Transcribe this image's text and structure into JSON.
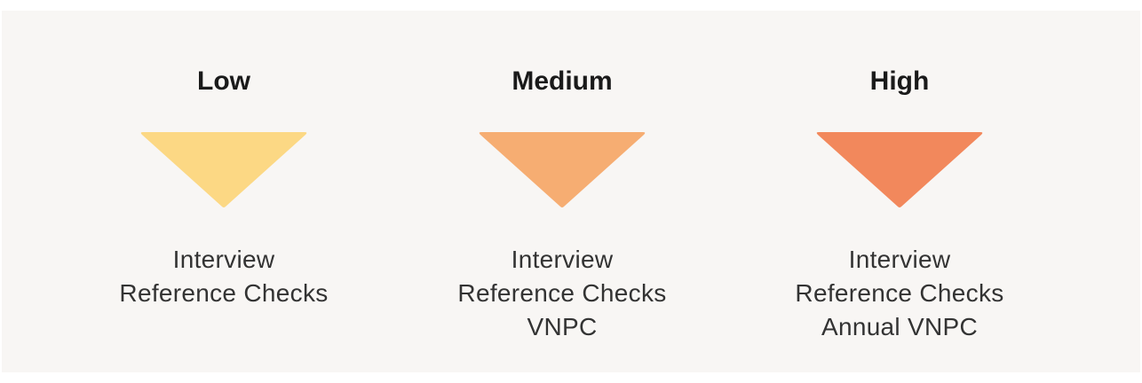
{
  "levels": [
    {
      "title": "Low",
      "color": "#fcd884",
      "items": [
        "Interview",
        "Reference Checks"
      ]
    },
    {
      "title": "Medium",
      "color": "#f6ad72",
      "items": [
        "Interview",
        "Reference Checks",
        "VNPC"
      ]
    },
    {
      "title": "High",
      "color": "#f2885c",
      "items": [
        "Interview",
        "Reference Checks",
        "Annual VNPC"
      ]
    }
  ]
}
